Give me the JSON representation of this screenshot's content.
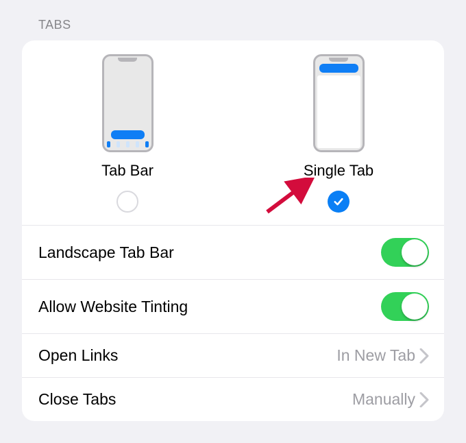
{
  "section_title": "TABS",
  "layout_options": {
    "tab_bar": {
      "label": "Tab Bar",
      "selected": false
    },
    "single_tab": {
      "label": "Single Tab",
      "selected": true
    }
  },
  "rows": {
    "landscape_tab_bar": {
      "label": "Landscape Tab Bar",
      "enabled": true
    },
    "allow_website_tinting": {
      "label": "Allow Website Tinting",
      "enabled": true
    },
    "open_links": {
      "label": "Open Links",
      "value": "In New Tab"
    },
    "close_tabs": {
      "label": "Close Tabs",
      "value": "Manually"
    }
  },
  "colors": {
    "accent": "#0a7ff5",
    "toggle_on": "#32d158",
    "background": "#f1f1f5",
    "annotation_arrow": "#d30c3c"
  }
}
